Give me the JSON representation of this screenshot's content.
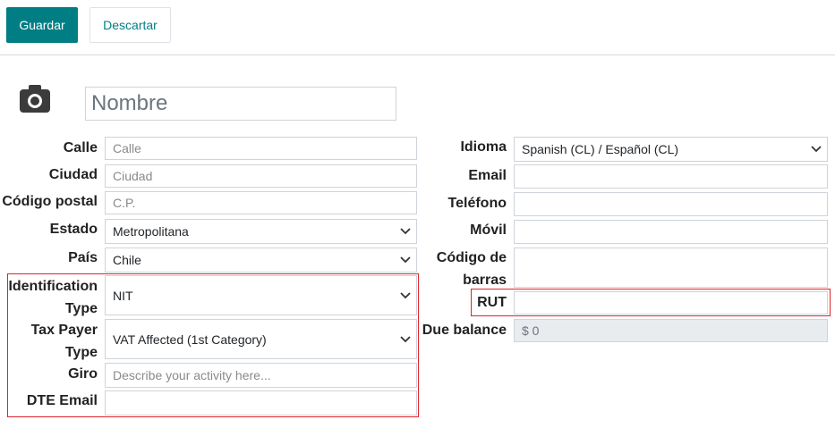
{
  "toolbar": {
    "save_label": "Guardar",
    "discard_label": "Descartar"
  },
  "name_placeholder": "Nombre",
  "left": {
    "calle_label": "Calle",
    "calle_placeholder": "Calle",
    "ciudad_label": "Ciudad",
    "ciudad_placeholder": "Ciudad",
    "cp_label": "Código postal",
    "cp_placeholder": "C.P.",
    "estado_label": "Estado",
    "estado_value": "Metropolitana",
    "pais_label": "País",
    "pais_value": "Chile",
    "id_type_label_1": "Identification",
    "id_type_label_2": "Type",
    "id_type_value": "NIT",
    "tax_label_1": "Tax Payer",
    "tax_label_2": "Type",
    "tax_value": "VAT Affected (1st Category)",
    "giro_label": "Giro",
    "giro_placeholder": "Describe your activity here...",
    "dte_label": "DTE Email"
  },
  "right": {
    "idioma_label": "Idioma",
    "idioma_value": "Spanish (CL) / Español (CL)",
    "email_label": "Email",
    "telefono_label": "Teléfono",
    "movil_label": "Móvil",
    "barcode_label_1": "Código de",
    "barcode_label_2": "barras",
    "rut_label": "RUT",
    "due_label": "Due balance",
    "due_value": "$ 0"
  },
  "colors": {
    "primary": "#017e84",
    "highlight": "#e0232b"
  }
}
